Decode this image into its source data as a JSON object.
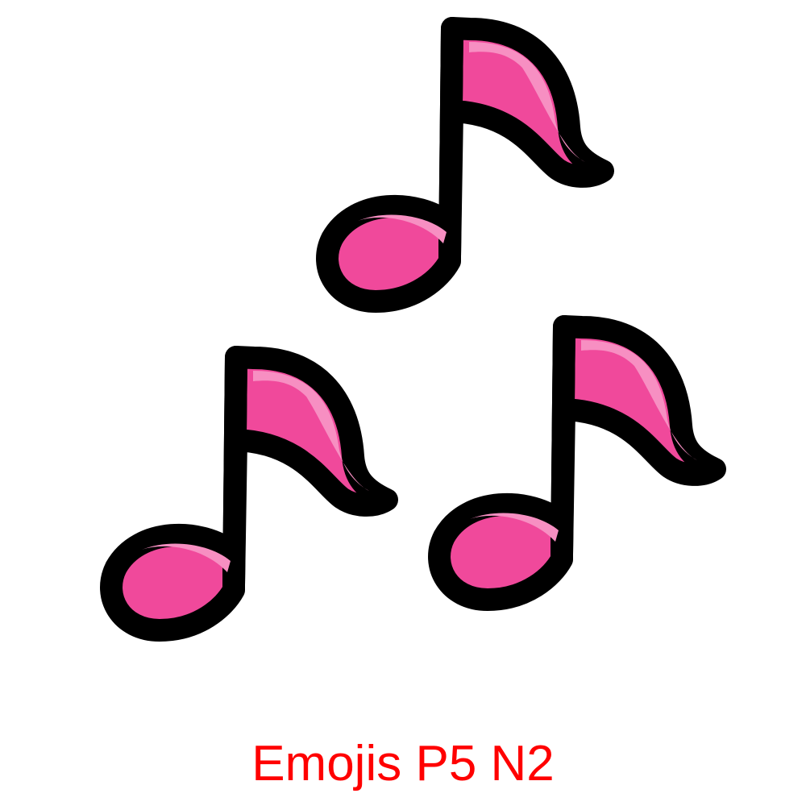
{
  "caption": "Emojis P5 N2",
  "emoji": {
    "name": "multiple-musical-notes",
    "icon": "music-notes-icon"
  },
  "colors": {
    "caption": "#ff0000",
    "outline": "#000000",
    "note_fill": "#f0499b",
    "note_highlight": "#f78fc2",
    "background": "#ffffff"
  }
}
